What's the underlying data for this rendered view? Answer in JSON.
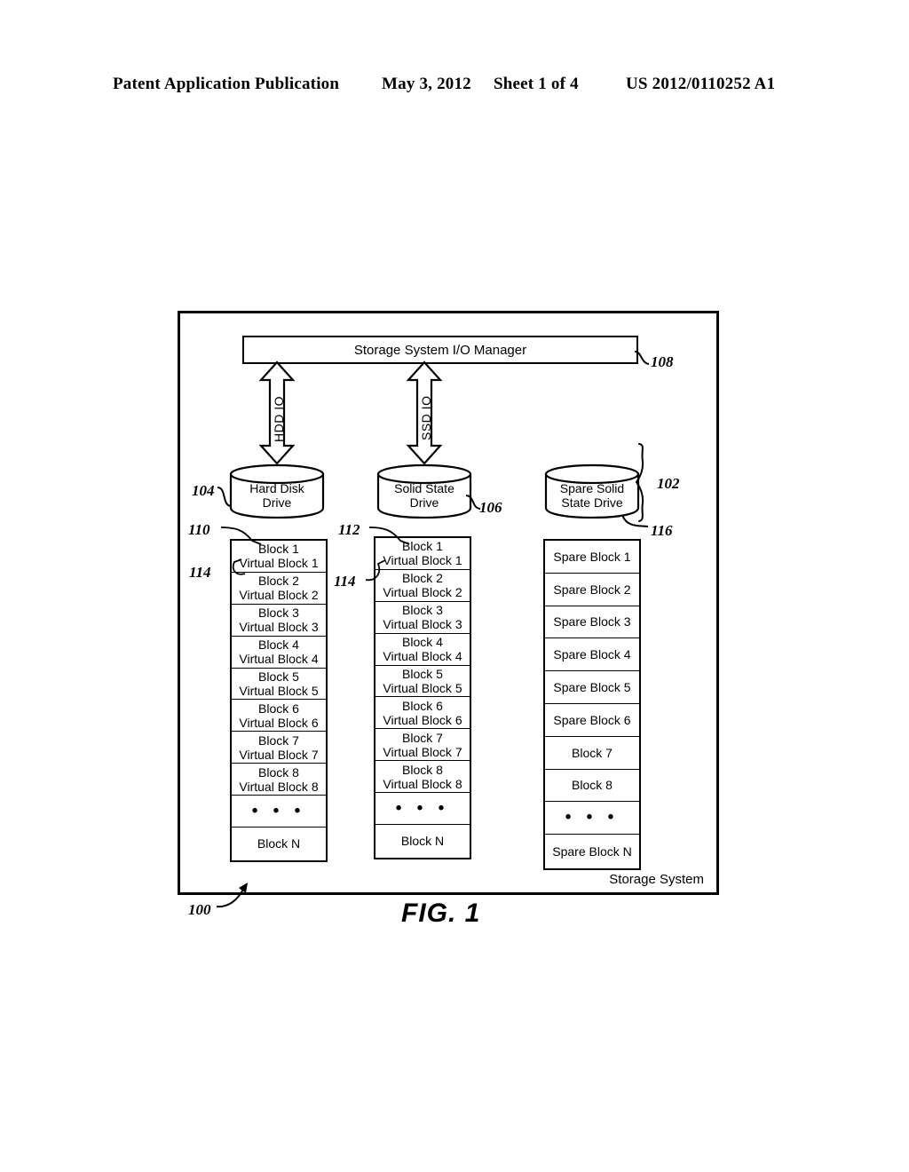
{
  "header": {
    "publication": "Patent Application Publication",
    "date": "May 3, 2012",
    "sheet": "Sheet 1 of 4",
    "number": "US 2012/0110252 A1"
  },
  "figure": {
    "caption": "FIG. 1",
    "system_label": "Storage System",
    "system_ref": "100"
  },
  "io_manager": {
    "label": "Storage System I/O Manager",
    "ref": "108"
  },
  "arrows": [
    {
      "label": "HDD IO"
    },
    {
      "label": "SSD IO"
    }
  ],
  "drives": [
    {
      "line1": "Hard Disk",
      "line2": "Drive",
      "ref": "104"
    },
    {
      "line1": "Solid State",
      "line2": "Drive",
      "ref": "106"
    },
    {
      "line1": "Spare Solid",
      "line2": "State Drive",
      "ref": "116"
    }
  ],
  "group_ref": "102",
  "columns": [
    {
      "ref_top": "110",
      "ref_inner": "114",
      "blocks": [
        {
          "line1": "Block 1",
          "line2": "Virtual Block 1"
        },
        {
          "line1": "Block 2",
          "line2": "Virtual Block 2"
        },
        {
          "line1": "Block 3",
          "line2": "Virtual Block 3"
        },
        {
          "line1": "Block 4",
          "line2": "Virtual Block 4"
        },
        {
          "line1": "Block 5",
          "line2": "Virtual Block 5"
        },
        {
          "line1": "Block 6",
          "line2": "Virtual Block 6"
        },
        {
          "line1": "Block 7",
          "line2": "Virtual Block 7"
        },
        {
          "line1": "Block 8",
          "line2": "Virtual Block 8"
        },
        {
          "line1": "• • •",
          "line2": ""
        },
        {
          "line1": "Block N",
          "line2": ""
        }
      ]
    },
    {
      "ref_top": "112",
      "ref_inner": "114",
      "blocks": [
        {
          "line1": "Block 1",
          "line2": "Virtual Block 1"
        },
        {
          "line1": "Block 2",
          "line2": "Virtual Block 2"
        },
        {
          "line1": "Block 3",
          "line2": "Virtual Block 3"
        },
        {
          "line1": "Block 4",
          "line2": "Virtual Block 4"
        },
        {
          "line1": "Block 5",
          "line2": "Virtual Block 5"
        },
        {
          "line1": "Block 6",
          "line2": "Virtual Block 6"
        },
        {
          "line1": "Block 7",
          "line2": "Virtual Block 7"
        },
        {
          "line1": "Block 8",
          "line2": "Virtual Block 8"
        },
        {
          "line1": "• • •",
          "line2": ""
        },
        {
          "line1": "Block N",
          "line2": ""
        }
      ]
    },
    {
      "ref_top": "",
      "ref_inner": "",
      "blocks": [
        {
          "line1": "Spare Block 1",
          "line2": ""
        },
        {
          "line1": "Spare Block 2",
          "line2": ""
        },
        {
          "line1": "Spare Block 3",
          "line2": ""
        },
        {
          "line1": "Spare Block 4",
          "line2": ""
        },
        {
          "line1": "Spare Block 5",
          "line2": ""
        },
        {
          "line1": "Spare Block 6",
          "line2": ""
        },
        {
          "line1": "Block 7",
          "line2": ""
        },
        {
          "line1": "Block 8",
          "line2": ""
        },
        {
          "line1": "• • •",
          "line2": ""
        },
        {
          "line1": "Spare Block N",
          "line2": ""
        }
      ]
    }
  ]
}
